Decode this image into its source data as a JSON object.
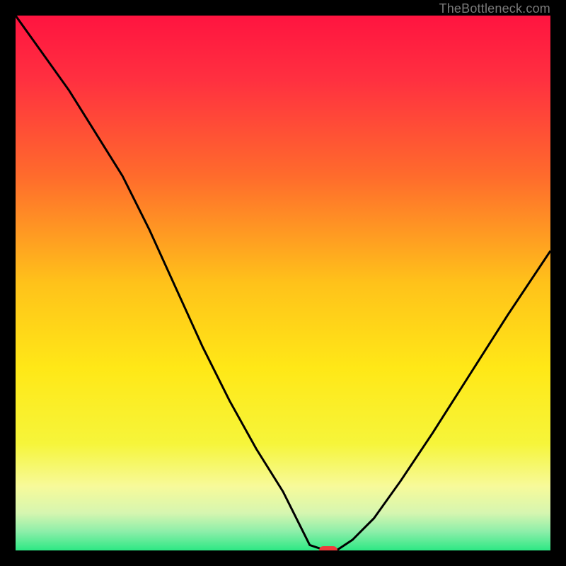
{
  "watermark": "TheBottleneck.com",
  "colors": {
    "border": "#000000",
    "curve": "#000000",
    "minpoint": "#ef3b3b",
    "gradient_stops": [
      {
        "offset": 0.0,
        "color": "#ff1440"
      },
      {
        "offset": 0.12,
        "color": "#ff3040"
      },
      {
        "offset": 0.3,
        "color": "#ff6b2c"
      },
      {
        "offset": 0.5,
        "color": "#ffc21a"
      },
      {
        "offset": 0.66,
        "color": "#ffe817"
      },
      {
        "offset": 0.8,
        "color": "#f6f53a"
      },
      {
        "offset": 0.88,
        "color": "#f7fa9a"
      },
      {
        "offset": 0.93,
        "color": "#d6f6b0"
      },
      {
        "offset": 0.965,
        "color": "#8ceea9"
      },
      {
        "offset": 1.0,
        "color": "#2de884"
      }
    ]
  },
  "chart_data": {
    "type": "line",
    "title": "",
    "xlabel": "",
    "ylabel": "",
    "xrange": [
      0,
      100
    ],
    "ylim": [
      0,
      100
    ],
    "x": [
      0,
      5,
      10,
      15,
      20,
      25,
      30,
      35,
      40,
      45,
      50,
      53,
      55,
      58,
      60,
      63,
      67,
      72,
      78,
      85,
      92,
      100
    ],
    "values": [
      100,
      93,
      86,
      78,
      70,
      60,
      49,
      38,
      28,
      19,
      11,
      5,
      1,
      0,
      0,
      2,
      6,
      13,
      22,
      33,
      44,
      56
    ],
    "min_point": {
      "x": 58.5,
      "y": 0
    },
    "annotations": []
  }
}
